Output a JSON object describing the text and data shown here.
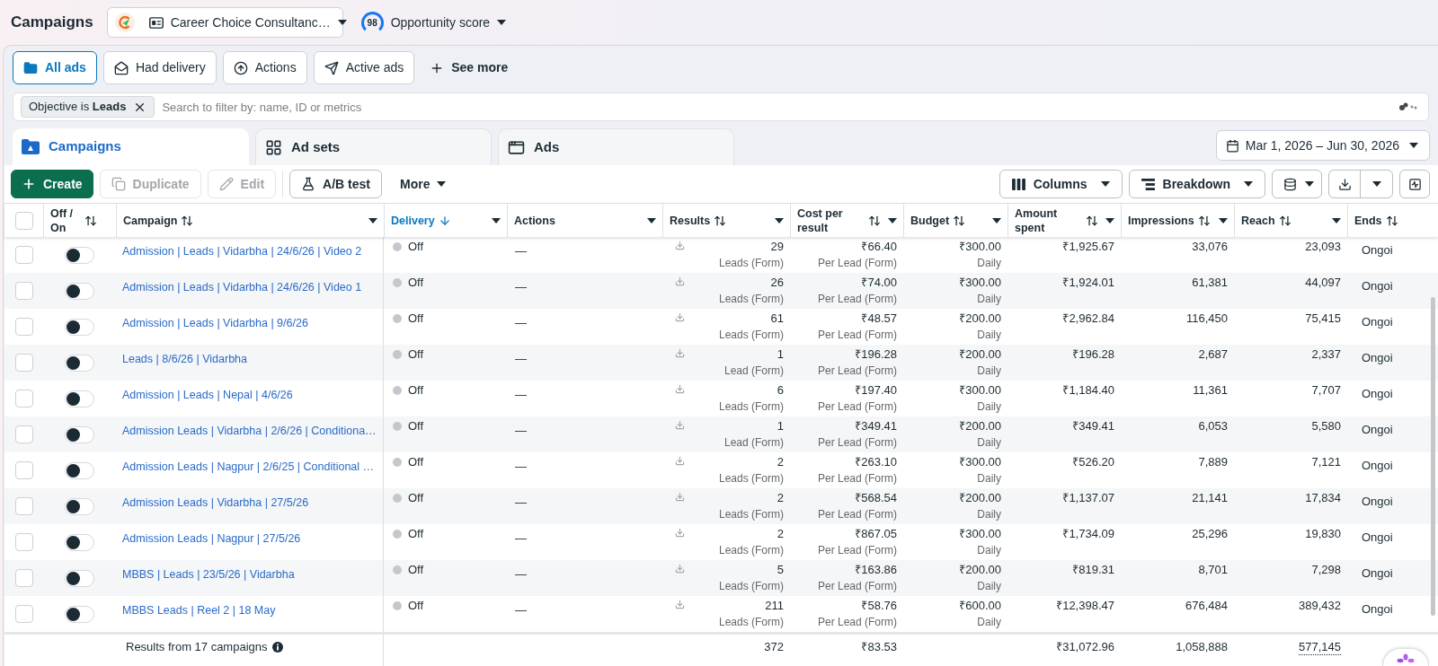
{
  "header": {
    "title": "Campaigns",
    "account": "Career Choice Consultanc…",
    "score": "98",
    "score_label": "Opportunity score"
  },
  "filters": [
    {
      "label": "All ads",
      "selected": true
    },
    {
      "label": "Had delivery",
      "selected": false
    },
    {
      "label": "Actions",
      "selected": false
    },
    {
      "label": "Active ads",
      "selected": false
    }
  ],
  "see_more": "See more",
  "search": {
    "chip": "Objective is **Leads**",
    "placeholder": "Search to filter by: name, ID or metrics"
  },
  "level_tabs": [
    {
      "label": "Campaigns",
      "selected": true
    },
    {
      "label": "Ad sets",
      "selected": false
    },
    {
      "label": "Ads",
      "selected": false
    }
  ],
  "date_range": "Mar 1, 2026 – Jun 30, 2026",
  "toolbar": {
    "actions": [
      {
        "label": "Create",
        "kind": "primary",
        "disabled": false
      },
      {
        "label": "Duplicate",
        "kind": "secondary",
        "disabled": true
      },
      {
        "label": "Edit",
        "kind": "secondary",
        "disabled": true
      },
      {
        "label": "A/B test",
        "kind": "secondary",
        "disabled": false
      },
      {
        "label": "More",
        "kind": "menu",
        "disabled": false
      }
    ],
    "views": [
      {
        "label": "Columns"
      },
      {
        "label": "Breakdown"
      }
    ]
  },
  "table": {
    "select_all": {
      "checked": false
    },
    "columns": [
      {
        "label": "Off / On",
        "sortable": true,
        "sorted": false,
        "menu": false
      },
      {
        "label": "Campaign",
        "sortable": true,
        "sorted": false,
        "menu": true
      },
      {
        "label": "Delivery",
        "sortable": true,
        "sorted": true,
        "menu": true
      },
      {
        "label": "Actions",
        "sortable": false,
        "sorted": false,
        "menu": true
      },
      {
        "label": "Results",
        "sortable": true,
        "sorted": false,
        "menu": true
      },
      {
        "label": "Cost per result",
        "sortable": true,
        "sorted": false,
        "menu": true
      },
      {
        "label": "Budget",
        "sortable": true,
        "sorted": false,
        "menu": true
      },
      {
        "label": "Amount spent",
        "sortable": true,
        "sorted": false,
        "menu": true
      },
      {
        "label": "Impressions",
        "sortable": true,
        "sorted": false,
        "menu": true
      },
      {
        "label": "Reach",
        "sortable": true,
        "sorted": false,
        "menu": true
      },
      {
        "label": "Ends",
        "sortable": true,
        "sorted": false,
        "menu": false
      }
    ],
    "rows": [
      {
        "checked": false,
        "on": false,
        "campaign": "Admission | Leads | Vidarbha | 24/6/26 | Video 2",
        "delivery": "Off",
        "actions": "—",
        "results": "29",
        "result_type": "Leads (Form)",
        "cost_per_result": "₹66.40",
        "cost_type": "Per Lead (Form)",
        "budget": "₹300.00",
        "budget_type": "Daily",
        "amount_spent": "₹1,925.67",
        "impressions": "33,076",
        "reach": "23,093",
        "ends": "Ongoi"
      },
      {
        "checked": false,
        "on": false,
        "campaign": "Admission | Leads | Vidarbha | 24/6/26 | Video 1",
        "delivery": "Off",
        "actions": "—",
        "results": "26",
        "result_type": "Leads (Form)",
        "cost_per_result": "₹74.00",
        "cost_type": "Per Lead (Form)",
        "budget": "₹300.00",
        "budget_type": "Daily",
        "amount_spent": "₹1,924.01",
        "impressions": "61,381",
        "reach": "44,097",
        "ends": "Ongoi"
      },
      {
        "checked": false,
        "on": false,
        "campaign": "Admission | Leads | Vidarbha | 9/6/26",
        "delivery": "Off",
        "actions": "—",
        "results": "61",
        "result_type": "Leads (Form)",
        "cost_per_result": "₹48.57",
        "cost_type": "Per Lead (Form)",
        "budget": "₹200.00",
        "budget_type": "Daily",
        "amount_spent": "₹2,962.84",
        "impressions": "116,450",
        "reach": "75,415",
        "ends": "Ongoi"
      },
      {
        "checked": false,
        "on": false,
        "campaign": "Leads | 8/6/26 | Vidarbha",
        "delivery": "Off",
        "actions": "—",
        "results": "1",
        "result_type": "Lead (Form)",
        "cost_per_result": "₹196.28",
        "cost_type": "Per Lead (Form)",
        "budget": "₹200.00",
        "budget_type": "Daily",
        "amount_spent": "₹196.28",
        "impressions": "2,687",
        "reach": "2,337",
        "ends": "Ongoi"
      },
      {
        "checked": false,
        "on": false,
        "campaign": "Admission | Leads | Nepal | 4/6/26",
        "delivery": "Off",
        "actions": "—",
        "results": "6",
        "result_type": "Leads (Form)",
        "cost_per_result": "₹197.40",
        "cost_type": "Per Lead (Form)",
        "budget": "₹300.00",
        "budget_type": "Daily",
        "amount_spent": "₹1,184.40",
        "impressions": "11,361",
        "reach": "7,707",
        "ends": "Ongoi"
      },
      {
        "checked": false,
        "on": false,
        "campaign": "Admission Leads | Vidarbha | 2/6/26 | Conditiona…",
        "delivery": "Off",
        "actions": "—",
        "results": "1",
        "result_type": "Lead (Form)",
        "cost_per_result": "₹349.41",
        "cost_type": "Per Lead (Form)",
        "budget": "₹200.00",
        "budget_type": "Daily",
        "amount_spent": "₹349.41",
        "impressions": "6,053",
        "reach": "5,580",
        "ends": "Ongoi"
      },
      {
        "checked": false,
        "on": false,
        "campaign": "Admission Leads | Nagpur | 2/6/25 | Conditional …",
        "delivery": "Off",
        "actions": "—",
        "results": "2",
        "result_type": "Leads (Form)",
        "cost_per_result": "₹263.10",
        "cost_type": "Per Lead (Form)",
        "budget": "₹300.00",
        "budget_type": "Daily",
        "amount_spent": "₹526.20",
        "impressions": "7,889",
        "reach": "7,121",
        "ends": "Ongoi"
      },
      {
        "checked": false,
        "on": false,
        "campaign": "Admission Leads | Vidarbha | 27/5/26",
        "delivery": "Off",
        "actions": "—",
        "results": "2",
        "result_type": "Leads (Form)",
        "cost_per_result": "₹568.54",
        "cost_type": "Per Lead (Form)",
        "budget": "₹200.00",
        "budget_type": "Daily",
        "amount_spent": "₹1,137.07",
        "impressions": "21,141",
        "reach": "17,834",
        "ends": "Ongoi"
      },
      {
        "checked": false,
        "on": false,
        "campaign": "Admission Leads | Nagpur | 27/5/26",
        "delivery": "Off",
        "actions": "—",
        "results": "2",
        "result_type": "Leads (Form)",
        "cost_per_result": "₹867.05",
        "cost_type": "Per Lead (Form)",
        "budget": "₹300.00",
        "budget_type": "Daily",
        "amount_spent": "₹1,734.09",
        "impressions": "25,296",
        "reach": "19,830",
        "ends": "Ongoi"
      },
      {
        "checked": false,
        "on": false,
        "campaign": "MBBS | Leads | 23/5/26 | Vidarbha",
        "delivery": "Off",
        "actions": "—",
        "results": "5",
        "result_type": "Leads (Form)",
        "cost_per_result": "₹163.86",
        "cost_type": "Per Lead (Form)",
        "budget": "₹200.00",
        "budget_type": "Daily",
        "amount_spent": "₹819.31",
        "impressions": "8,701",
        "reach": "7,298",
        "ends": "Ongoi"
      },
      {
        "checked": false,
        "on": false,
        "campaign": "MBBS Leads | Reel 2 | 18 May",
        "delivery": "Off",
        "actions": "—",
        "results": "211",
        "result_type": "Leads (Form)",
        "cost_per_result": "₹58.76",
        "cost_type": "Per Lead (Form)",
        "budget": "₹600.00",
        "budget_type": "Daily",
        "amount_spent": "₹12,398.47",
        "impressions": "676,484",
        "reach": "389,432",
        "ends": "Ongoi"
      }
    ],
    "footer": {
      "label": "Results from 17 campaigns",
      "results": "372",
      "cost_per_result": "₹83.53",
      "amount_spent": "₹31,072.96",
      "impressions": "1,058,888",
      "reach": "577,145"
    }
  }
}
